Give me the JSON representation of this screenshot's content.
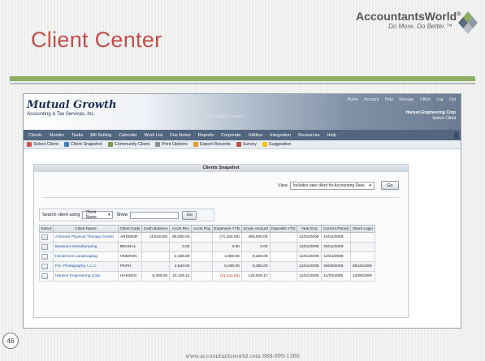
{
  "slide": {
    "title": "Client Center",
    "page_number": "46",
    "footer": "www.accountantsworld.com 888-999-1366"
  },
  "logo": {
    "wordmark": "AccountantsWorld",
    "trademark": "®",
    "tagline": "Do More. Do Better.™"
  },
  "app": {
    "brand_line1": "Mutual Growth",
    "brand_line2": "Accounting & Tax Services, Inc.",
    "top_links": [
      "Home",
      "Account",
      "Help",
      "Manage",
      "Office",
      "Log",
      "Out"
    ],
    "client_name": "Hansen Engineering Corp",
    "client_sub": "Switch Client",
    "center_caption": "Accountants Center™",
    "menu": [
      "Clients",
      "Monitor",
      "Tasks",
      "Bill Setting",
      "Calendar",
      "Work List",
      "Fee Notes",
      "Reports",
      "Corporate",
      "Utilities",
      "Integration",
      "Resources",
      "Help"
    ],
    "toolbar": [
      "Select Client",
      "Client Snapshot",
      "Community Client",
      "Print Options",
      "Export Records",
      "Survey",
      "Suggestion"
    ]
  },
  "panel": {
    "title": "Clients Snapshot",
    "view_label": "View",
    "view_select": "Includes new client for Accounting Fees",
    "go_label": "Go",
    "search_label": "Search client using",
    "search_field": "Client Name",
    "search_for_label": "Show",
    "search_go": "Go"
  },
  "table": {
    "headers": [
      "Select",
      "Client Name",
      "Client Code",
      "Cash Balance",
      "Accts Rec",
      "Accts Pay",
      "Expenses YTD",
      "Gross Amount",
      "Deposits YTD",
      "Year End",
      "Current Period",
      "Client Login"
    ],
    "rows": [
      [
        "",
        "Ardmore Physical Therapy Center",
        "ARDMOR",
        "(4,618.00)",
        "80,000.00",
        "",
        "(71,204.00)",
        "480,000.00",
        "",
        "12/31/2009",
        "10/31/2009",
        ""
      ],
      [
        "",
        "Banana's Manufacturing",
        "BNANA1",
        "",
        "0.00",
        "",
        "0.00",
        "0.00",
        "",
        "12/31/2009",
        "05/31/2009",
        ""
      ],
      [
        "",
        "Henderson Landscaping",
        "HNDRSN",
        "",
        "2,105.00",
        "",
        "1,800.00",
        "8,250.00",
        "",
        "12/31/2009",
        "12/31/2009",
        ""
      ],
      [
        "",
        "P.K. Photography, L.L.C",
        "PKPH",
        "",
        "2,840.00",
        "",
        "5,290.00",
        "8,395.00",
        "",
        "12/31/2009",
        "09/30/2009",
        "06/15/2009"
      ],
      [
        "",
        "Hansen Engineering Corp",
        "HANSEN",
        "8,409.00",
        "21,325.11",
        "",
        "(11,411.84)",
        "123,928.17",
        "",
        "12/31/2009",
        "11/30/2009",
        "12/06/2009"
      ]
    ]
  },
  "colors": {
    "title_red": "#c0504d",
    "rule_green": "#8fae63",
    "menubar": "#53667f",
    "link_blue": "#2a4fa8"
  }
}
